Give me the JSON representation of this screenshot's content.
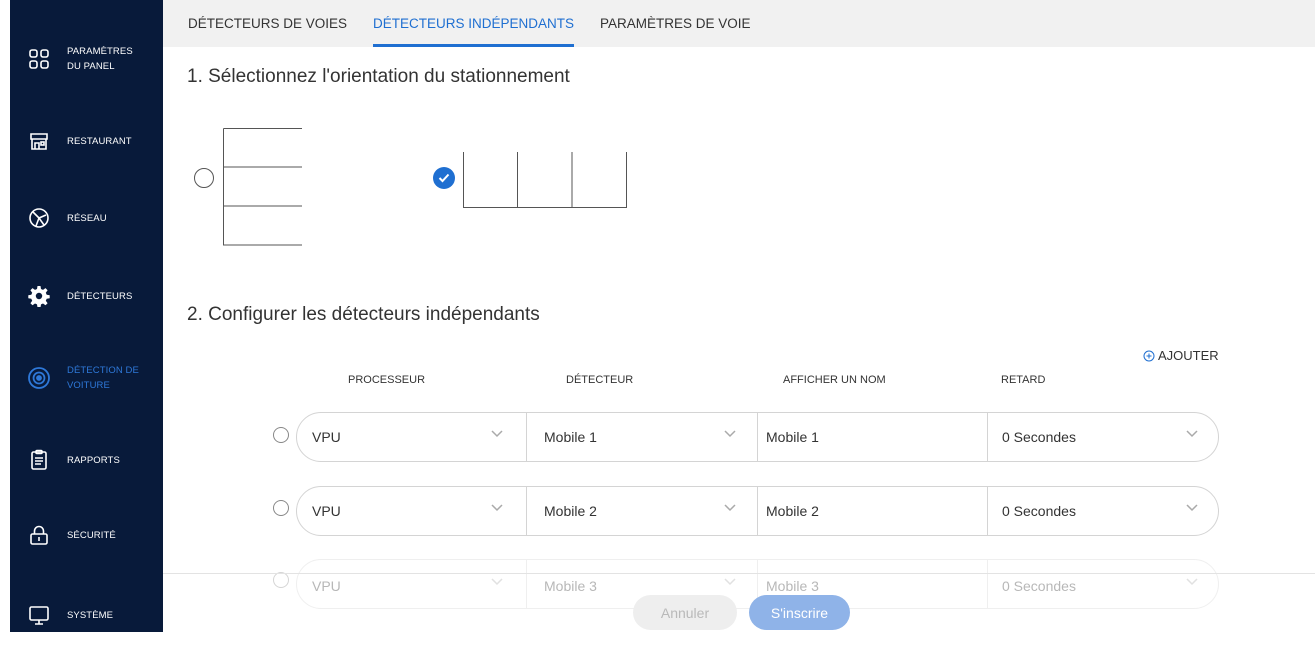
{
  "sidebar": {
    "items": [
      {
        "label_1": "PARAMÈTRES",
        "label_2": "DU PANEL",
        "icon": "grid-icon"
      },
      {
        "label_1": "RESTAURANT",
        "label_2": "",
        "icon": "storefront-icon"
      },
      {
        "label_1": "RÉSEAU",
        "label_2": "",
        "icon": "network-globe-icon"
      },
      {
        "label_1": "DÉTECTEURS",
        "label_2": "",
        "icon": "gear-icon"
      },
      {
        "label_1": "DÉTECTION DE",
        "label_2": "VOITURE",
        "icon": "radar-icon",
        "active": true
      },
      {
        "label_1": "RAPPORTS",
        "label_2": "",
        "icon": "clipboard-icon"
      },
      {
        "label_1": "SÉCURITÉ",
        "label_2": "",
        "icon": "lock-icon"
      },
      {
        "label_1": "SYSTÈME",
        "label_2": "",
        "icon": "monitor-icon"
      }
    ]
  },
  "tabs": [
    {
      "label": "DÉTECTEURS DE VOIES"
    },
    {
      "label": "DÉTECTEURS INDÉPENDANTS",
      "active": true
    },
    {
      "label": "PARAMÈTRES DE VOIE"
    }
  ],
  "section1": {
    "title": "1. Sélectionnez l'orientation du stationnement"
  },
  "section2": {
    "title": "2. Configurer les détecteurs indépendants",
    "add_label": "AJOUTER"
  },
  "table": {
    "headers": {
      "processor": "PROCESSEUR",
      "detector": "DÉTECTEUR",
      "display_name": "AFFICHER UN NOM",
      "delay": "RETARD"
    },
    "rows": [
      {
        "processor": "VPU",
        "detector": "Mobile 1",
        "name": "Mobile 1",
        "delay": "0 Secondes"
      },
      {
        "processor": "VPU",
        "detector": "Mobile 2",
        "name": "Mobile 2",
        "delay": "0 Secondes"
      },
      {
        "processor": "VPU",
        "detector": "Mobile 3",
        "name": "Mobile 3",
        "delay": "0 Secondes"
      }
    ]
  },
  "footer": {
    "cancel": "Annuler",
    "submit": "S'inscrire"
  },
  "colors": {
    "sidebar_bg": "#081a3a",
    "accent": "#1f6fd1"
  }
}
